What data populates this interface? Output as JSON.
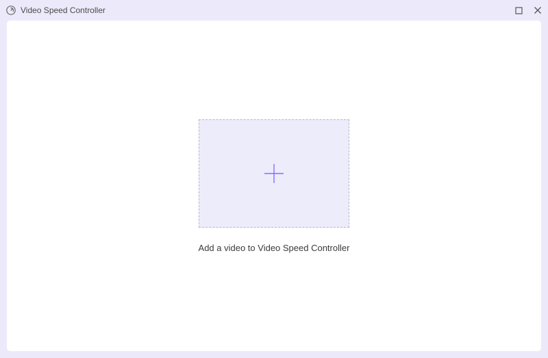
{
  "titlebar": {
    "title": "Video Speed Controller"
  },
  "main": {
    "instruction": "Add a video to Video Speed Controller"
  }
}
